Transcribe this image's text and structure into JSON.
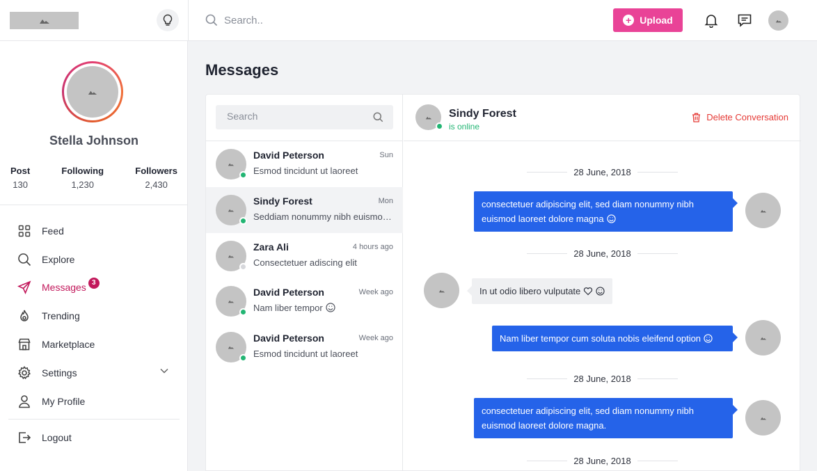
{
  "topbar": {
    "search_placeholder": "Search..",
    "upload_label": "Upload",
    "accent_color": "#e94397"
  },
  "sidebar": {
    "profile_name": "Stella Johnson",
    "stats": [
      {
        "label": "Post",
        "value": "130"
      },
      {
        "label": "Following",
        "value": "1,230"
      },
      {
        "label": "Followers",
        "value": "2,430"
      }
    ],
    "nav": [
      {
        "label": "Feed",
        "icon": "grid-icon"
      },
      {
        "label": "Explore",
        "icon": "search-icon"
      },
      {
        "label": "Messages",
        "icon": "send-icon",
        "badge": "3",
        "active": true
      },
      {
        "label": "Trending",
        "icon": "flame-icon"
      },
      {
        "label": "Marketplace",
        "icon": "store-icon"
      },
      {
        "label": "Settings",
        "icon": "gear-icon"
      },
      {
        "label": "My Profile",
        "icon": "user-icon"
      }
    ],
    "logout_label": "Logout"
  },
  "main": {
    "title": "Messages",
    "conversation_search_placeholder": "Search",
    "conversations": [
      {
        "name": "David Peterson",
        "time": "Sun",
        "preview": "Esmod tincidunt ut laoreet",
        "status": "online"
      },
      {
        "name": "Sindy Forest",
        "time": "Mon",
        "preview": "Seddiam nonummy nibh euismod laoreet",
        "status": "online",
        "selected": true
      },
      {
        "name": "Zara Ali",
        "time": "4 hours ago",
        "preview": "Consectetuer adiscing elit",
        "status": "offline"
      },
      {
        "name": "David Peterson",
        "time": "Week ago",
        "preview": "Nam liber tempor",
        "status": "online",
        "emoji": true
      },
      {
        "name": "David Peterson",
        "time": "Week ago",
        "preview": "Esmod tincidunt ut laoreet",
        "status": "online"
      }
    ],
    "chat": {
      "contact_name": "Sindy Forest",
      "contact_status": "is online",
      "delete_label": "Delete Conversation",
      "dates": [
        "28 June, 2018",
        "28 June, 2018",
        "28 June, 2018",
        "28 June, 2018"
      ],
      "messages": [
        {
          "direction": "out",
          "line1": "consectetuer adipiscing elit, sed diam nonummy nibh",
          "line2": "euismod laoreet dolore magna"
        },
        {
          "direction": "in",
          "line1": "In ut odio libero vulputate"
        },
        {
          "direction": "out",
          "line1": "Nam liber tempor cum soluta nobis eleifend option"
        },
        {
          "direction": "out",
          "line1": "consectetuer adipiscing elit, sed diam nonummy nibh",
          "line2": "euismod laoreet dolore magna."
        }
      ]
    }
  },
  "colors": {
    "online": "#22b573",
    "outgoing_bubble": "#2563e9",
    "active_nav": "#c2185b",
    "delete": "#e53935"
  }
}
